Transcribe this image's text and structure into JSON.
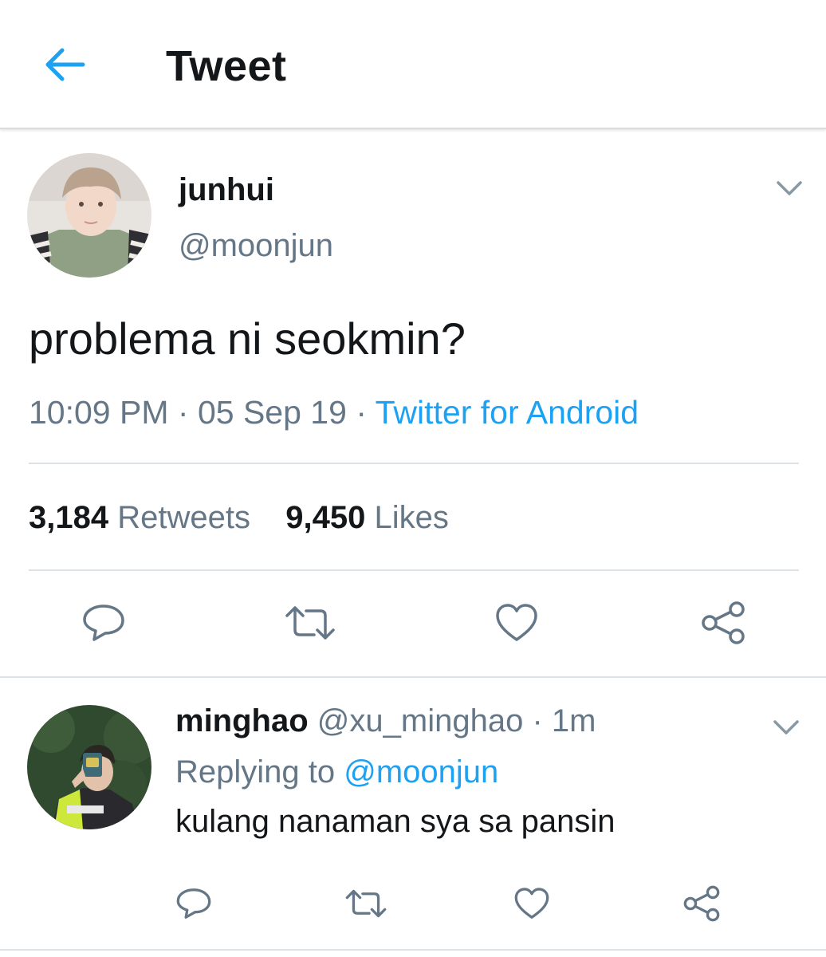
{
  "header": {
    "title": "Tweet",
    "back_icon": "arrow-left-icon",
    "accent": "#1da1f2"
  },
  "tweet": {
    "author": {
      "name": "junhui",
      "handle": "@moonjun"
    },
    "text": "problema ni seokmin?",
    "time": "10:09 PM",
    "separator": "·",
    "date": "05 Sep 19",
    "source": "Twitter for Android",
    "stats": {
      "retweets_count": "3,184",
      "retweets_label": "Retweets",
      "likes_count": "9,450",
      "likes_label": "Likes"
    },
    "actions": [
      "reply-icon",
      "retweet-icon",
      "like-icon",
      "share-icon"
    ]
  },
  "reply": {
    "author": {
      "name": "minghao",
      "handle": "@xu_minghao"
    },
    "separator": "·",
    "time_ago": "1m",
    "replying_to_label": "Replying to",
    "replying_to_handle": "@moonjun",
    "text": "kulang nanaman sya sa pansin",
    "actions": [
      "reply-icon",
      "retweet-icon",
      "like-icon",
      "share-icon"
    ]
  },
  "colors": {
    "text_primary": "#14171a",
    "text_secondary": "#657786",
    "link": "#1da1f2",
    "divider": "#dde2e6"
  }
}
